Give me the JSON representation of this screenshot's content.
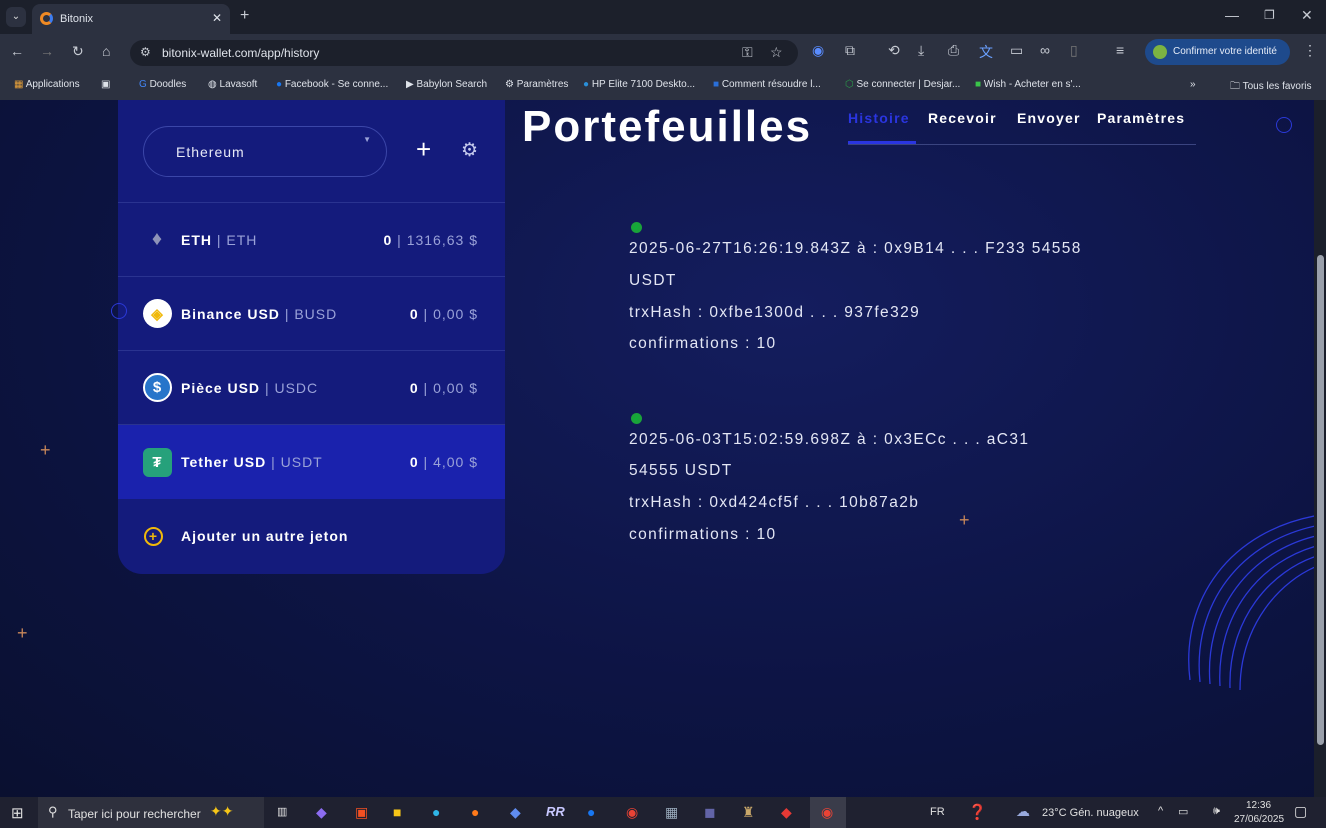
{
  "browser": {
    "tab_title": "Bitonix",
    "url": "bitonix-wallet.com/app/history",
    "profile_button": "Confirmer votre identité",
    "bookmarks": [
      "Applications",
      "Doodles",
      "Lavasoft",
      "Facebook - Se conne...",
      "Babylon Search",
      "Paramètres",
      "HP Elite 7100 Deskto...",
      "Comment résoudre l...",
      "Se connecter | Desjar...",
      "Wish - Acheter en s'..."
    ],
    "all_bookmarks": "Tous les favoris"
  },
  "wallet": {
    "network": "Ethereum",
    "tokens": [
      {
        "name": "ETH",
        "symbol": "ETH",
        "amount": "0",
        "value": "1316,63 $",
        "icon": "ethereum-icon"
      },
      {
        "name": "Binance USD",
        "symbol": "BUSD",
        "amount": "0",
        "value": "0,00 $",
        "icon": "binance-icon"
      },
      {
        "name": "Pièce USD",
        "symbol": "USDC",
        "amount": "0",
        "value": "0,00 $",
        "icon": "usdc-icon"
      },
      {
        "name": "Tether USD",
        "symbol": "USDT",
        "amount": "0",
        "value": "4,00 $",
        "icon": "tether-icon"
      }
    ],
    "add_token": "Ajouter un autre jeton"
  },
  "main": {
    "title": "Portefeuilles",
    "tabs": [
      "Histoire",
      "Recevoir",
      "Envoyer",
      "Paramètres"
    ],
    "active_tab": "Histoire",
    "transactions": [
      {
        "line1": "2025-06-27T16:26:19.843Z à : 0x9B14 . . . F233 54558",
        "line2": "USDT",
        "hash": "trxHash : 0xfbe1300d . . . 937fe329",
        "confirmations": "confirmations : 10"
      },
      {
        "line1": "2025-06-03T15:02:59.698Z à : 0x3ECc . . . aC31",
        "line2": "54555 USDT",
        "hash": "trxHash : 0xd424cf5f . . . 10b87a2b",
        "confirmations": "confirmations : 10"
      }
    ]
  },
  "taskbar": {
    "search_placeholder": "Taper ici pour rechercher",
    "lang": "FR",
    "weather": "23°C  Gén. nuageux",
    "time": "12:36",
    "date": "27/06/2025"
  },
  "colors": {
    "accent": "#2a35e0",
    "card": "#141b7c",
    "active_row": "#1a22ad"
  }
}
